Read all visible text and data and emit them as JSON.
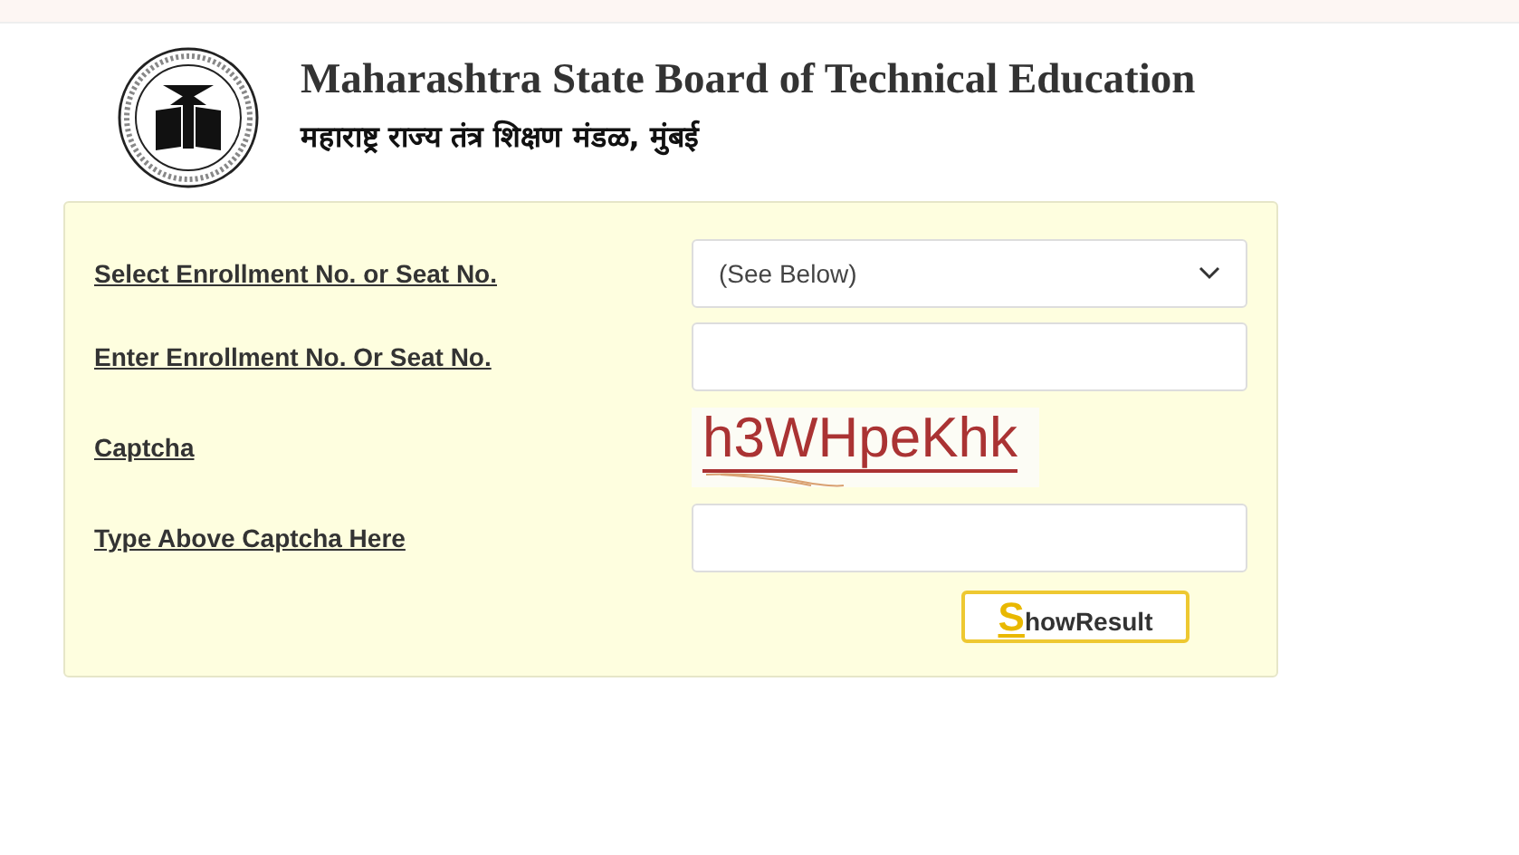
{
  "header": {
    "title": "Maharashtra State Board of Technical Education",
    "subtitle": "महाराष्ट्र राज्य तंत्र शिक्षण मंडळ, मुंबई"
  },
  "form": {
    "rows": [
      {
        "kind": "select",
        "label": "Select Enrollment No. or Seat No.",
        "value": "(See Below)"
      },
      {
        "kind": "input",
        "label": "Enter Enrollment No. Or Seat No."
      },
      {
        "kind": "captcha",
        "label": "Captcha",
        "value": "h3WHpeKhk"
      },
      {
        "kind": "input",
        "label": "Type Above Captcha Here"
      }
    ],
    "button": {
      "label": "ShowResult"
    }
  }
}
